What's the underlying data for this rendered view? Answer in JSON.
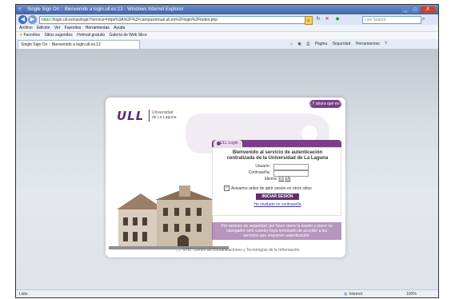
{
  "window": {
    "title": "Single Sign On :: Bienvenido a login.ull.es:12 - Windows Internet Explorer",
    "minimize": "_",
    "maximize": "□",
    "close": "X"
  },
  "address_bar": {
    "scheme": "https://",
    "url": "login.ull.es/cas/login?service=https%3A%2F%2Fcampusvirtual.ull.es%2Flogin%2Findex.php",
    "search_placeholder": "Live Search"
  },
  "menu": [
    "Archivo",
    "Edición",
    "Ver",
    "Favoritos",
    "Herramientas",
    "Ayuda"
  ],
  "favorites_bar": {
    "label": "Favoritos",
    "items": [
      "Sitios sugeridos",
      "Hotmail gratuito",
      "Galería de Web Slice"
    ]
  },
  "tab": {
    "title": "Single Sign On :: Bienvenido a login.ull.es:12"
  },
  "command_bar": [
    "Página",
    "Seguridad",
    "Herramientas"
  ],
  "page": {
    "help_button": "¿Y ahora qué es?",
    "logo": "ULL",
    "logo_text_1": "Universidad",
    "logo_text_2": "de La Laguna",
    "login_tab": "ULL Login",
    "welcome_1": "Bienvenido al servicio de autenticación",
    "welcome_2": "centralizada de la Universidad de La Laguna",
    "user_label": "Usuario:",
    "password_label": "Contraseña:",
    "language_label": "Idioma:",
    "lang_es": "ES",
    "lang_en": "EN",
    "remember_label": "Avisarme antes de abrir sesión en otros sitios",
    "submit": "INICIAR SESIÓN",
    "forgot": "He olvidado mi contraseña",
    "notice_1": "Por razones de seguridad, por favor cierre la sesión y cierre su",
    "notice_2": "navegador web cuando haya terminado de acceder a los",
    "notice_3": "servicios que requieren autenticación.",
    "footer": "STIC: Centro de Comunicaciones y Tecnologías de la Información"
  },
  "status_bar": {
    "left": "Listo",
    "zone": "Internet",
    "zoom": "100%"
  }
}
